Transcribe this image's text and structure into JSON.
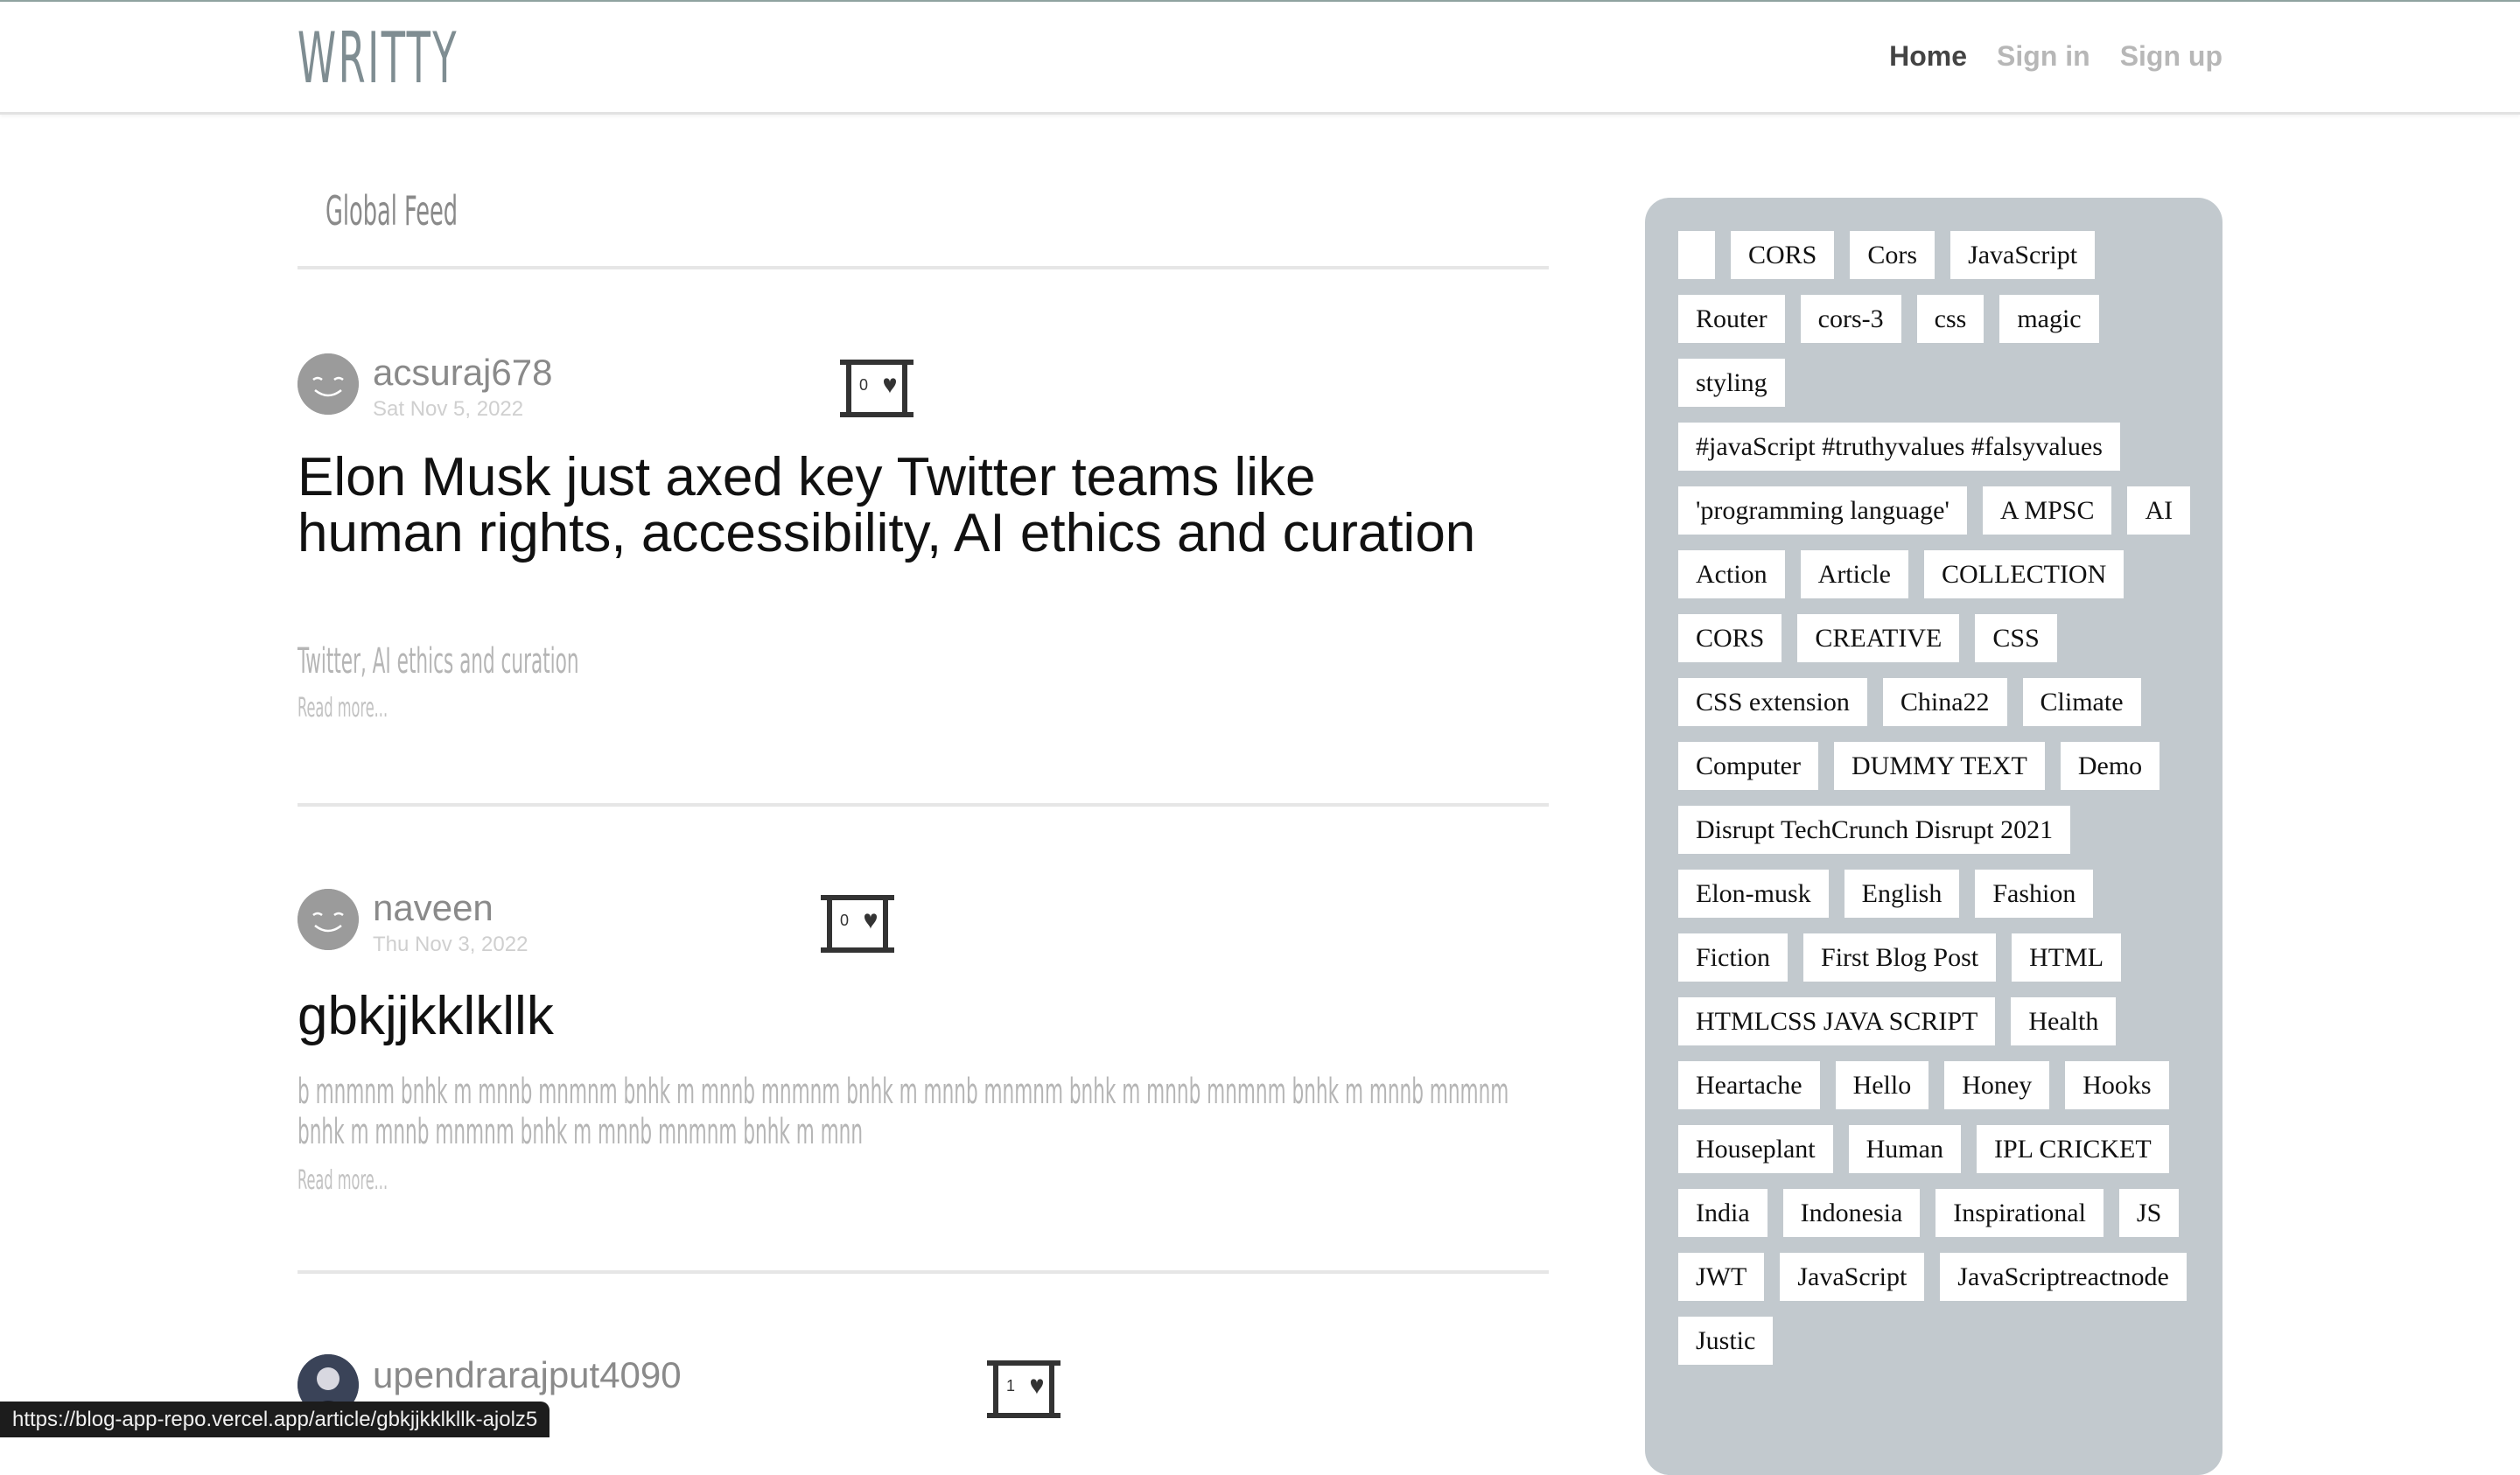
{
  "nav": {
    "brand": "WRITTY",
    "links": [
      {
        "label": "Home",
        "active": true
      },
      {
        "label": "Sign in",
        "active": false
      },
      {
        "label": "Sign up",
        "active": false
      }
    ]
  },
  "feed": {
    "tab_label": "Global Feed",
    "articles": [
      {
        "author": "acsuraj678",
        "date": "Sat Nov 5, 2022",
        "likes": "0",
        "title": "Elon Musk just axed key Twitter teams like human rights, accessibility, AI ethics and curation",
        "description": "Twitter, AI ethics and curation",
        "read_more": "Read more..."
      },
      {
        "author": "naveen",
        "date": "Thu Nov 3, 2022",
        "likes": "0",
        "title": "gbkjjkklkllk",
        "description_line1": "b mnmnm bnhk m mnnb mnmnm bnhk m mnnb mnmnm bnhk m mnnb mnmnm bnhk m mnnb mnmnm bnhk m mnnb mnmnm",
        "description_line2": "bnhk m mnnb mnmnm bnhk m mnnb mnmnm bnhk m mnn",
        "read_more": "Read more..."
      },
      {
        "author": "upendrarajput4090",
        "likes": "1"
      }
    ]
  },
  "tags": [
    "",
    "CORS",
    "Cors",
    "JavaScript",
    "Router",
    "cors-3",
    "css",
    "magic",
    "styling",
    "#javaScript #truthyvalues #falsyvalues",
    "'programming language'",
    "A MPSC",
    "AI",
    "Action",
    "Article",
    "COLLECTION",
    "CORS",
    "CREATIVE",
    "CSS",
    "CSS extension",
    "China22",
    "Climate",
    "Computer",
    "DUMMY TEXT",
    "Demo",
    "Disrupt TechCrunch Disrupt 2021",
    "Elon-musk",
    "English",
    "Fashion",
    "Fiction",
    "First Blog Post",
    "HTML",
    "HTMLCSS JAVA SCRIPT",
    "Health",
    "Heartache",
    "Hello",
    "Honey",
    "Hooks",
    "Houseplant",
    "Human",
    "IPL CRICKET",
    "India",
    "Indonesia",
    "Inspirational",
    "JS",
    "JWT",
    "JavaScript",
    "JavaScriptreactnode",
    "Justic"
  ],
  "status_url": "https://blog-app-repo.vercel.app/article/gbkjjkklkllk-ajolz5",
  "colors": {
    "sidebar_bg": "#c2c9ce",
    "brand": "#7f8d92",
    "nav_active": "#444444",
    "nav_inactive": "#b7b7b7"
  }
}
